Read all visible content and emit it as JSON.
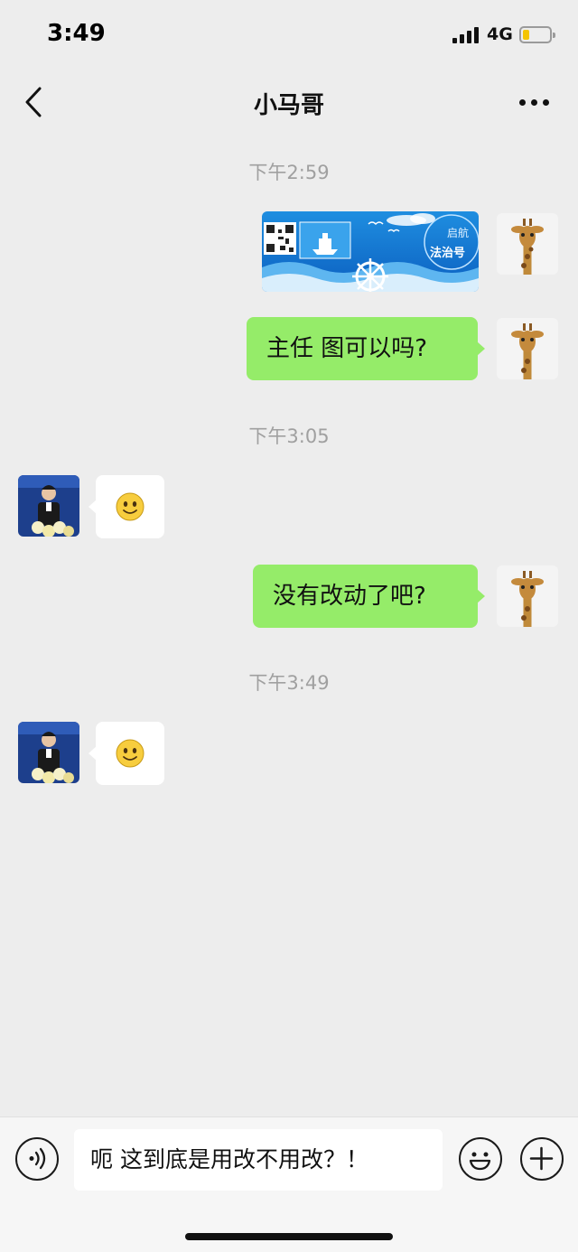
{
  "status_bar": {
    "time": "3:49",
    "network": "4G",
    "battery_level": 0.25
  },
  "nav": {
    "title": "小马哥"
  },
  "messages": [
    {
      "type": "time",
      "text": "下午2:59"
    },
    {
      "type": "image",
      "sender": "me",
      "image_text": "法治号",
      "image_text2": "启航"
    },
    {
      "type": "text",
      "sender": "me",
      "text": "主任 图可以吗?"
    },
    {
      "type": "time",
      "text": "下午3:05"
    },
    {
      "type": "emoji",
      "sender": "contact",
      "emoji": "smile"
    },
    {
      "type": "text",
      "sender": "me",
      "text": "没有改动了吧?"
    },
    {
      "type": "time",
      "text": "下午3:49"
    },
    {
      "type": "emoji",
      "sender": "contact",
      "emoji": "smile"
    }
  ],
  "input": {
    "value": "呃 这到底是用改不用改？！"
  },
  "colors": {
    "bubble_me": "#95ec69",
    "bubble_contact": "#ffffff",
    "background": "#ededed"
  }
}
